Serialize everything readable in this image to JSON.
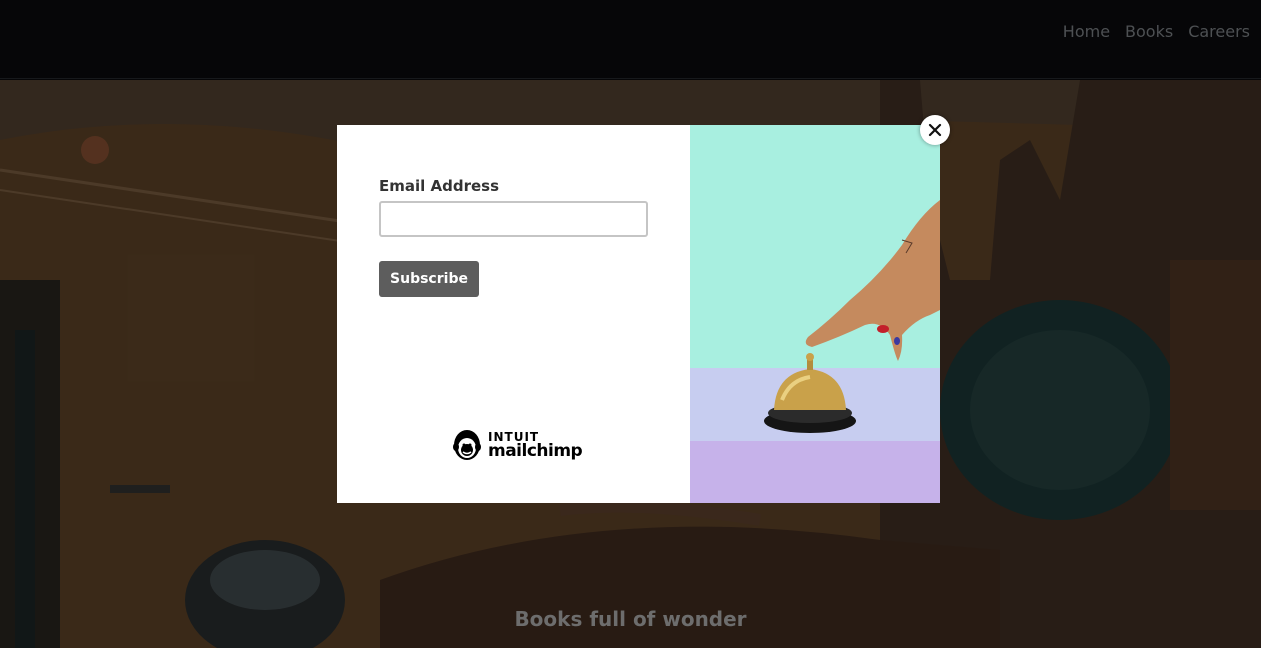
{
  "nav": {
    "items": [
      "Home",
      "Books",
      "Careers"
    ]
  },
  "hero": {
    "tagline": "Books full of wonder"
  },
  "modal": {
    "email_label": "Email Address",
    "email_value": "",
    "subscribe_label": "Subscribe",
    "brand_top": "INTUIT",
    "brand_bottom": "mailchimp",
    "close_icon": "close-icon"
  },
  "colors": {
    "topbar": "#0b0c0f",
    "button": "#5d5d5d",
    "mint": "#a8efe0",
    "lavender": "#c9b9ea"
  }
}
